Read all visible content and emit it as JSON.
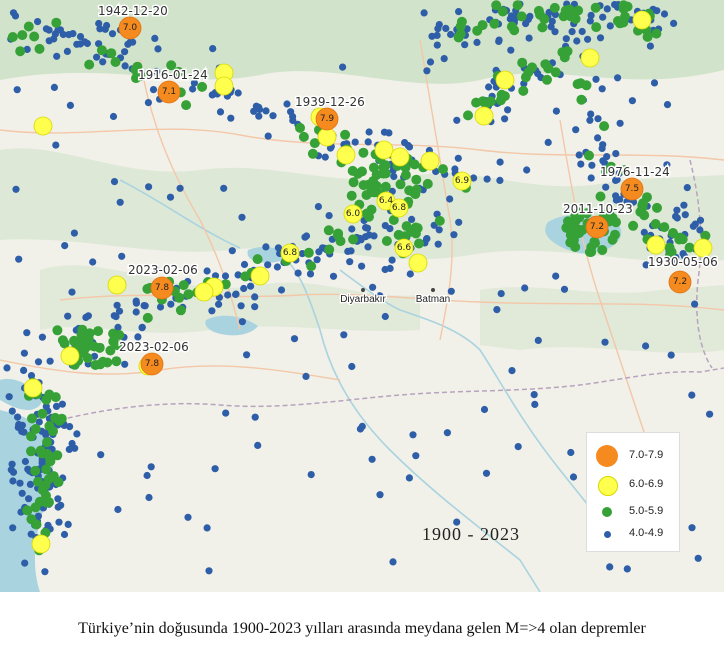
{
  "map": {
    "period": "1900 - 2023",
    "cities": [
      {
        "name": "Diyarbakır"
      },
      {
        "name": "Batman"
      }
    ],
    "major_events": [
      {
        "date": "1942-12-20",
        "magnitude": "7.0"
      },
      {
        "date": "1916-01-24",
        "magnitude": "7.1"
      },
      {
        "date": "1939-12-26",
        "magnitude": "7.9"
      },
      {
        "date": "1976-11-24",
        "magnitude": "7.5"
      },
      {
        "date": "2011-10-23",
        "magnitude": "7.2"
      },
      {
        "date": "1930-05-06",
        "magnitude": "7.2"
      },
      {
        "date": "2023-02-06",
        "magnitude": "7.8"
      },
      {
        "date": "2023-02-06",
        "magnitude": "7.8"
      }
    ],
    "labeled_moderate_events": [
      "6.9",
      "6.4",
      "6.8",
      "6.0",
      "6.6",
      "6.8"
    ],
    "colors": {
      "m7": "#f58a1f",
      "m6": "#ffff4d",
      "m5": "#36a136",
      "m4": "#2e5ea8",
      "land": "#f1f1e9",
      "water": "#a9d3df",
      "relief": "#c7dec0",
      "road": "#f3c7a8",
      "border": "#b8a3bf"
    }
  },
  "legend": {
    "items": [
      {
        "range": "7.0-7.9",
        "color": "#f58a1f",
        "size": "large"
      },
      {
        "range": "6.0-6.9",
        "color": "#ffff4d",
        "size": "medium"
      },
      {
        "range": "5.0-5.9",
        "color": "#36a136",
        "size": "small"
      },
      {
        "range": "4.0-4.9",
        "color": "#2e5ea8",
        "size": "tiny"
      }
    ]
  },
  "caption": "Türkiye’nin doğusunda 1900-2023 yılları arasında meydana gelen M=>4 olan depremler"
}
